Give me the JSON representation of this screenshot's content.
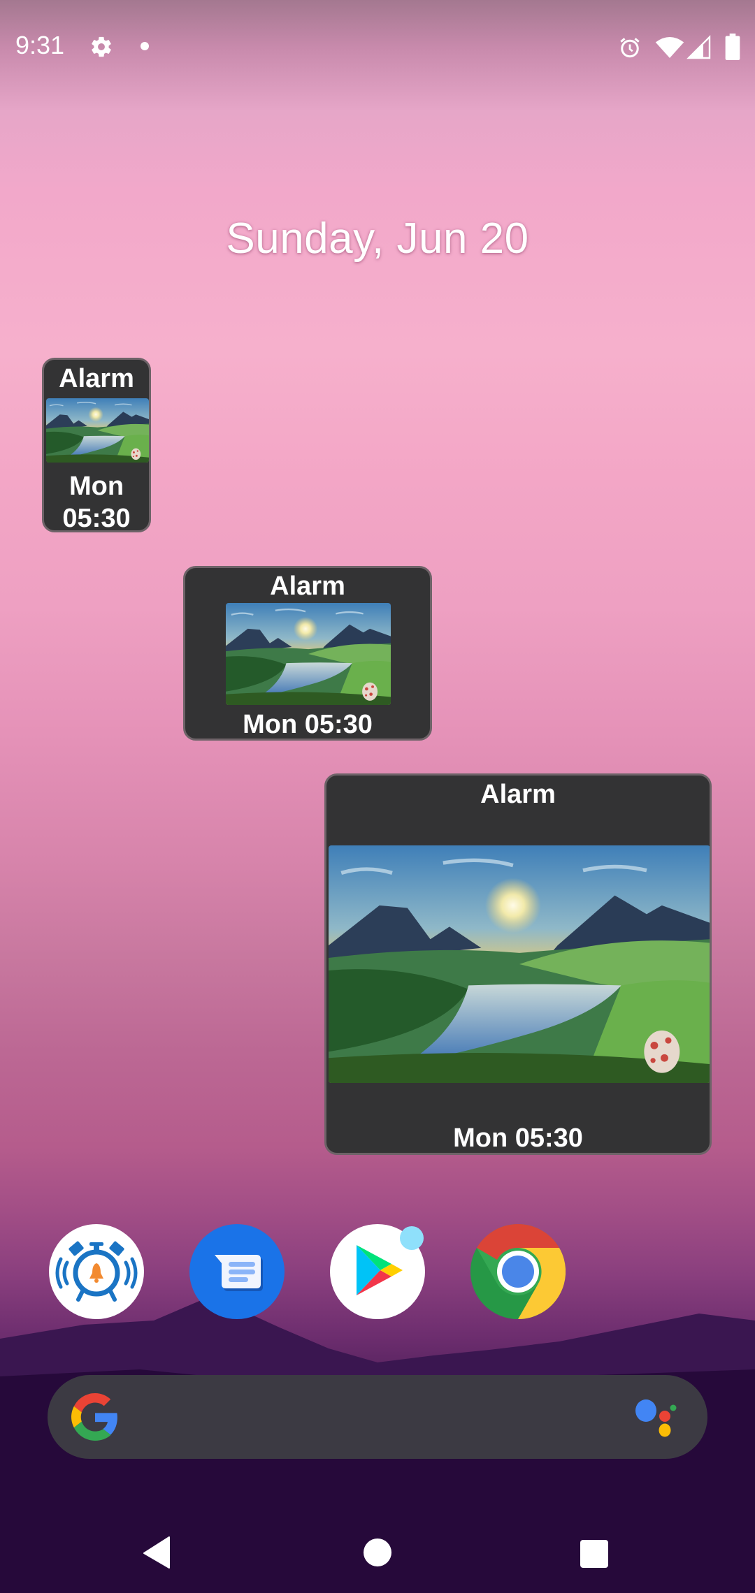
{
  "status_bar": {
    "time": "9:31",
    "left_icons": [
      "gear-icon",
      "notification-dot-icon"
    ],
    "right_icons": [
      "alarm-clock-icon",
      "wifi-icon",
      "signal-icon",
      "battery-icon"
    ]
  },
  "date_header": "Sunday, Jun 20",
  "widgets": [
    {
      "size": "small",
      "title": "Alarm",
      "day": "Mon",
      "time": "05:30",
      "combined": "Mon 05:30"
    },
    {
      "size": "medium",
      "title": "Alarm",
      "day": "Mon",
      "time": "05:30",
      "combined": "Mon 05:30"
    },
    {
      "size": "large",
      "title": "Alarm",
      "day": "Mon",
      "time": "05:30",
      "combined": "Mon 05:30"
    }
  ],
  "dock": {
    "apps": [
      {
        "name": "Alarm Clock",
        "icon": "alarm-clock-app-icon",
        "has_badge": false
      },
      {
        "name": "Messages",
        "icon": "messages-app-icon",
        "has_badge": false
      },
      {
        "name": "Play Store",
        "icon": "play-store-app-icon",
        "has_badge": true
      },
      {
        "name": "Chrome",
        "icon": "chrome-app-icon",
        "has_badge": false
      }
    ],
    "badge_color": "#8fe0fb"
  },
  "search_bar": {
    "left_icon": "google-g-icon",
    "right_icon": "google-assistant-icon",
    "placeholder": ""
  },
  "nav_bar": {
    "buttons": [
      "back",
      "home",
      "recents"
    ]
  },
  "colors": {
    "widget_bg": "#333334",
    "search_bg": "#3c3a43",
    "google_blue": "#4285f4",
    "google_red": "#ea4335",
    "google_yellow": "#fbbc05",
    "google_green": "#34a853"
  }
}
